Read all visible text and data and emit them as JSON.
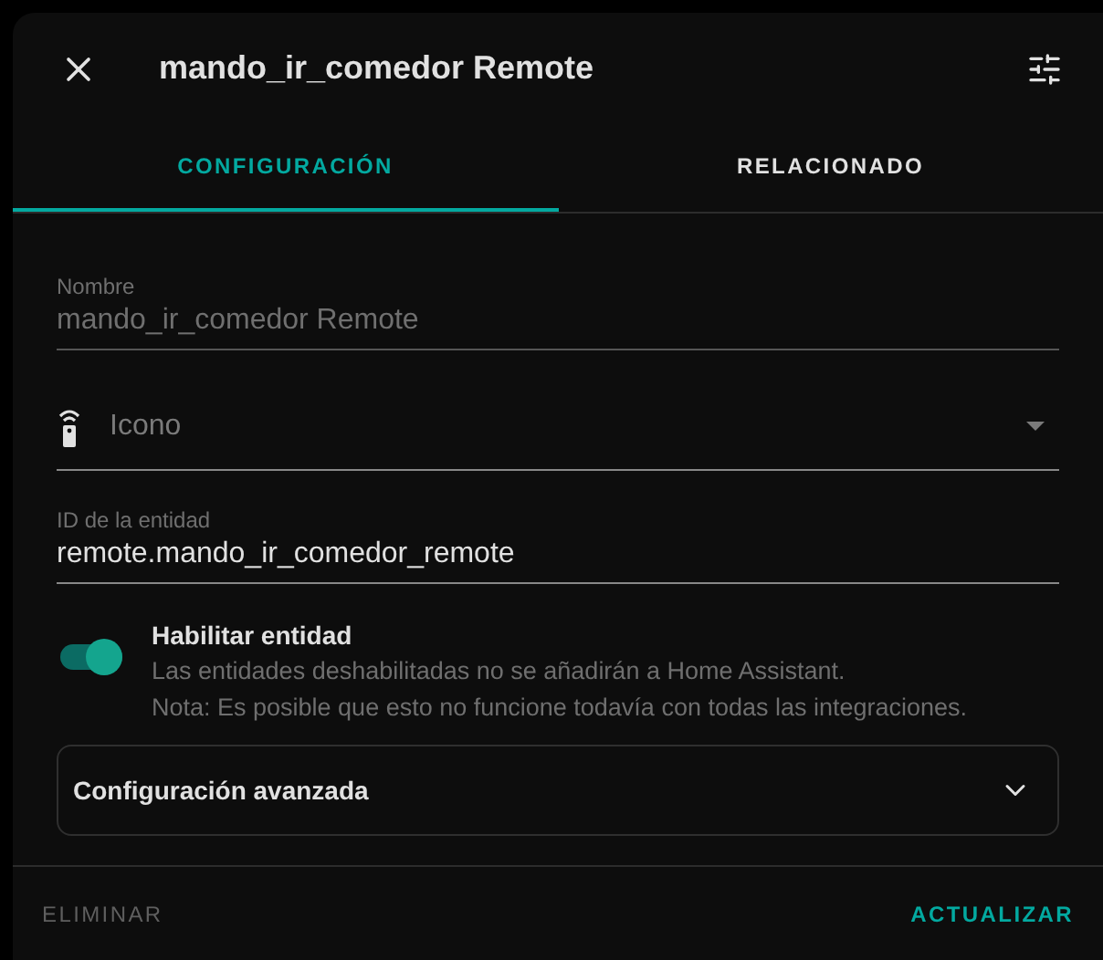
{
  "dialog": {
    "title": "mando_ir_comedor Remote"
  },
  "tabs": [
    {
      "label": "CONFIGURACIÓN",
      "selected": true
    },
    {
      "label": "RELACIONADO",
      "selected": false
    }
  ],
  "fields": [
    {
      "kind": "text",
      "label": "Nombre",
      "value": "mando_ir_comedor Remote",
      "disabled": true
    },
    {
      "kind": "icon",
      "placeholder": "Icono"
    },
    {
      "kind": "text",
      "label": "ID de la entidad",
      "value": "remote.mando_ir_comedor_remote",
      "disabled": false
    }
  ],
  "enable": {
    "label": "Habilitar entidad",
    "on": true,
    "notes": [
      "Las entidades deshabilitadas no se añadirán a Home Assistant.",
      "Nota: Es posible que esto no funcione todavía con todas las integraciones."
    ]
  },
  "advanced": {
    "label": "Configuración avanzada",
    "expanded": false
  },
  "footer": {
    "delete": "ELIMINAR",
    "update": "ACTUALIZAR"
  }
}
